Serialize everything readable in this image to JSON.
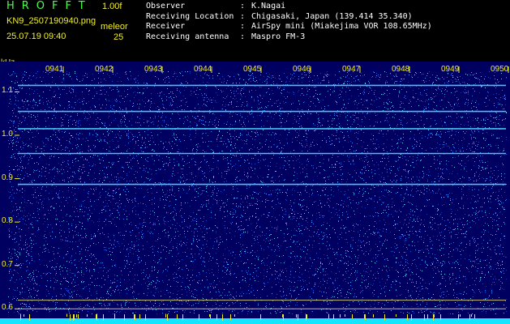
{
  "header": {
    "app_title": "HROFFT",
    "version": "1.00f",
    "filename": "KN9_2507190940.png",
    "datetime": "25.07.19 09:40",
    "unit_label": "meleor",
    "unit_value": "25"
  },
  "info": [
    {
      "key": "Observer",
      "value": "K.Nagai"
    },
    {
      "key": "Receiving Location",
      "value": "Chigasaki, Japan (139.414 35.340)"
    },
    {
      "key": "Receiver",
      "value": "AirSpy mini (Miakejima VOR 108.65MHz)"
    },
    {
      "key": "Receiving antenna",
      "value": "Maspro FM-3"
    }
  ],
  "separator": ":",
  "spectrogram": {
    "freq_unit": "kHz",
    "freq_ticks": [
      "1.1",
      "1.0",
      "0.9",
      "0.8",
      "0.7",
      "0.6"
    ],
    "time_ticks": [
      "0941",
      "0942",
      "0943",
      "0944",
      "0945",
      "0946",
      "0947",
      "0948",
      "0949",
      "0950"
    ],
    "freq_range": [
      0.58,
      1.14
    ],
    "carrier_lines_khz": [
      1.115,
      1.055,
      1.015,
      0.958,
      0.887
    ],
    "reference_lines_khz": [
      0.62,
      0.6
    ],
    "colors": {
      "background": "#000060",
      "carrier": "#4fd7ff",
      "reference": "#e8e37c",
      "noise": "#2b7bff",
      "label": "#f2ef2a"
    }
  }
}
